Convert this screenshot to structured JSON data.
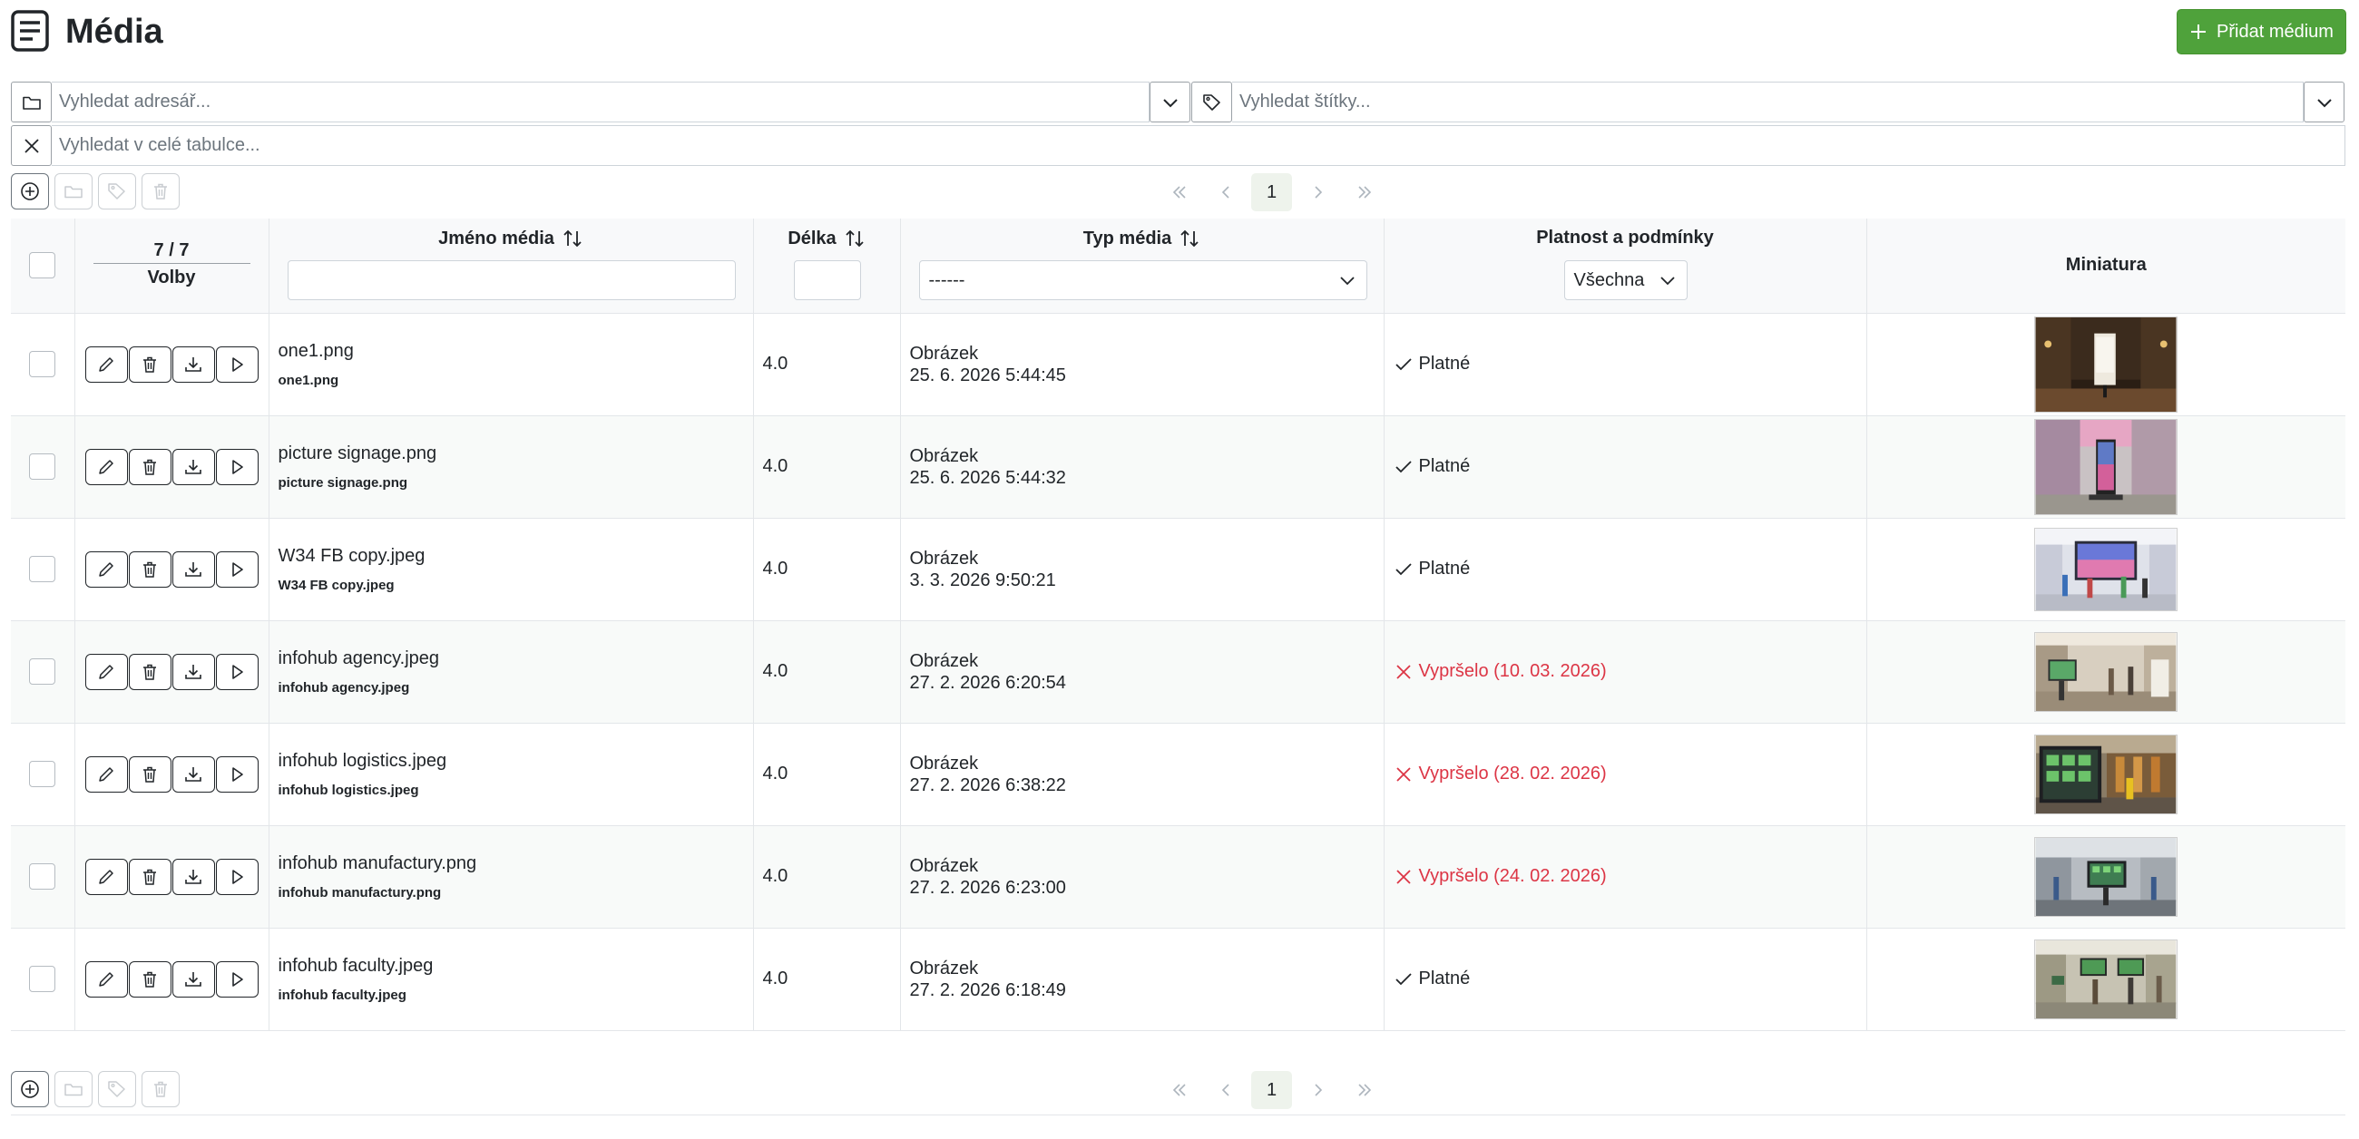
{
  "header": {
    "title": "Média",
    "add_button_label": "Přidat médium"
  },
  "filters": {
    "folder_placeholder": "Vyhledat adresář...",
    "tags_placeholder": "Vyhledat štítky...",
    "search_placeholder": "Vyhledat v celé tabulce..."
  },
  "pagination": {
    "current_page": "1"
  },
  "table": {
    "counter": "7 / 7",
    "options_label": "Volby",
    "columns": {
      "name": "Jméno média",
      "length": "Délka",
      "type": "Typ média",
      "validity": "Platnost a podmínky",
      "thumbnail": "Miniatura"
    },
    "type_filter_value": "------",
    "validity_filter_value": "Všechna",
    "rows": [
      {
        "name": "one1.png",
        "filename": "one1.png",
        "length": "4.0",
        "type": "Obrázek",
        "date": "25. 6. 2026 5:44:45",
        "validity": "Platné",
        "expired": false
      },
      {
        "name": "picture signage.png",
        "filename": "picture signage.png",
        "length": "4.0",
        "type": "Obrázek",
        "date": "25. 6. 2026 5:44:32",
        "validity": "Platné",
        "expired": false
      },
      {
        "name": "W34 FB copy.jpeg",
        "filename": "W34 FB copy.jpeg",
        "length": "4.0",
        "type": "Obrázek",
        "date": "3. 3. 2026 9:50:21",
        "validity": "Platné",
        "expired": false
      },
      {
        "name": "infohub agency.jpeg",
        "filename": "infohub agency.jpeg",
        "length": "4.0",
        "type": "Obrázek",
        "date": "27. 2. 2026 6:20:54",
        "validity": "Vypršelo (10. 03. 2026)",
        "expired": true
      },
      {
        "name": "infohub logistics.jpeg",
        "filename": "infohub logistics.jpeg",
        "length": "4.0",
        "type": "Obrázek",
        "date": "27. 2. 2026 6:38:22",
        "validity": "Vypršelo (28. 02. 2026)",
        "expired": true
      },
      {
        "name": "infohub manufactury.png",
        "filename": "infohub manufactury.png",
        "length": "4.0",
        "type": "Obrázek",
        "date": "27. 2. 2026 6:23:00",
        "validity": "Vypršelo (24. 02. 2026)",
        "expired": true
      },
      {
        "name": "infohub faculty.jpeg",
        "filename": "infohub faculty.jpeg",
        "length": "4.0",
        "type": "Obrázek",
        "date": "27. 2. 2026 6:18:49",
        "validity": "Platné",
        "expired": false
      }
    ]
  },
  "colors": {
    "primary_green": "#4fa23b",
    "expired_red": "#dc3545"
  }
}
